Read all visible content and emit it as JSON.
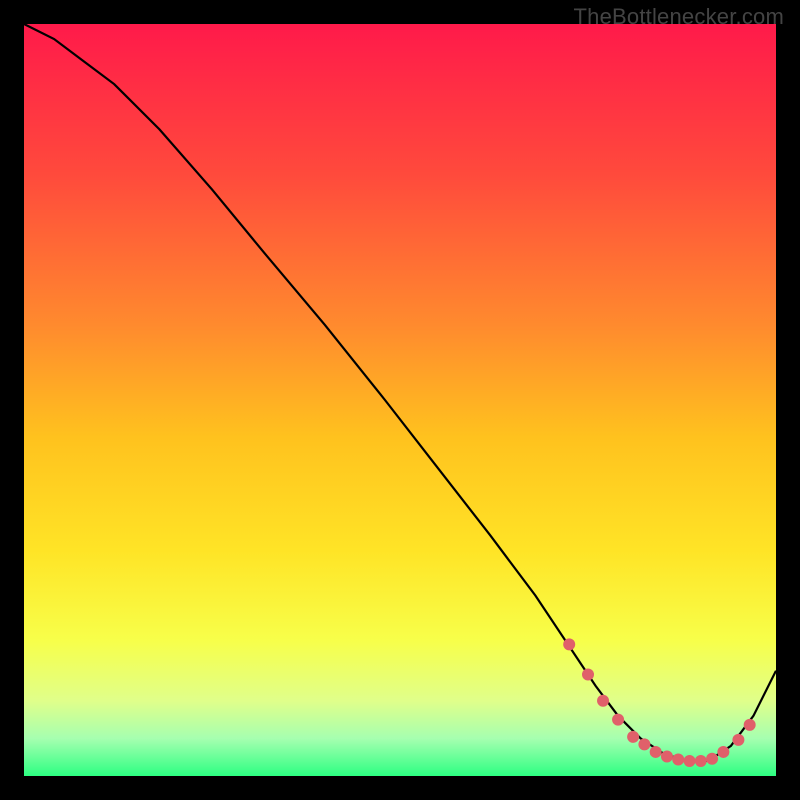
{
  "watermark": "TheBottlenecker.com",
  "chart_data": {
    "type": "line",
    "title": "",
    "xlabel": "",
    "ylabel": "",
    "xlim": [
      0,
      100
    ],
    "ylim": [
      0,
      100
    ],
    "background_gradient": {
      "stops": [
        {
          "offset": 0.0,
          "color": "#ff1a4a"
        },
        {
          "offset": 0.2,
          "color": "#ff4a3c"
        },
        {
          "offset": 0.4,
          "color": "#ff8a2e"
        },
        {
          "offset": 0.55,
          "color": "#ffc21e"
        },
        {
          "offset": 0.7,
          "color": "#ffe426"
        },
        {
          "offset": 0.82,
          "color": "#f7ff4a"
        },
        {
          "offset": 0.9,
          "color": "#e0ff8a"
        },
        {
          "offset": 0.95,
          "color": "#a6ffb0"
        },
        {
          "offset": 1.0,
          "color": "#2dff82"
        }
      ]
    },
    "series": [
      {
        "name": "bottleneck-curve",
        "color": "#000000",
        "x": [
          0,
          4,
          8,
          12,
          18,
          25,
          32,
          40,
          48,
          55,
          62,
          68,
          72,
          76,
          79,
          82,
          85,
          88,
          91,
          94,
          97,
          100
        ],
        "y": [
          100,
          98,
          95,
          92,
          86,
          78,
          69.5,
          60,
          50,
          41,
          32,
          24,
          18,
          12,
          8,
          5,
          3,
          2,
          2,
          4,
          8,
          14
        ]
      }
    ],
    "markers": {
      "name": "flat-region-dots",
      "color": "#e0606a",
      "radius": 6,
      "x": [
        72.5,
        75,
        77,
        79,
        81,
        82.5,
        84,
        85.5,
        87,
        88.5,
        90,
        91.5,
        93,
        95,
        96.5
      ],
      "y": [
        17.5,
        13.5,
        10,
        7.5,
        5.2,
        4.2,
        3.2,
        2.6,
        2.2,
        2.0,
        2.0,
        2.3,
        3.2,
        4.8,
        6.8
      ]
    }
  }
}
